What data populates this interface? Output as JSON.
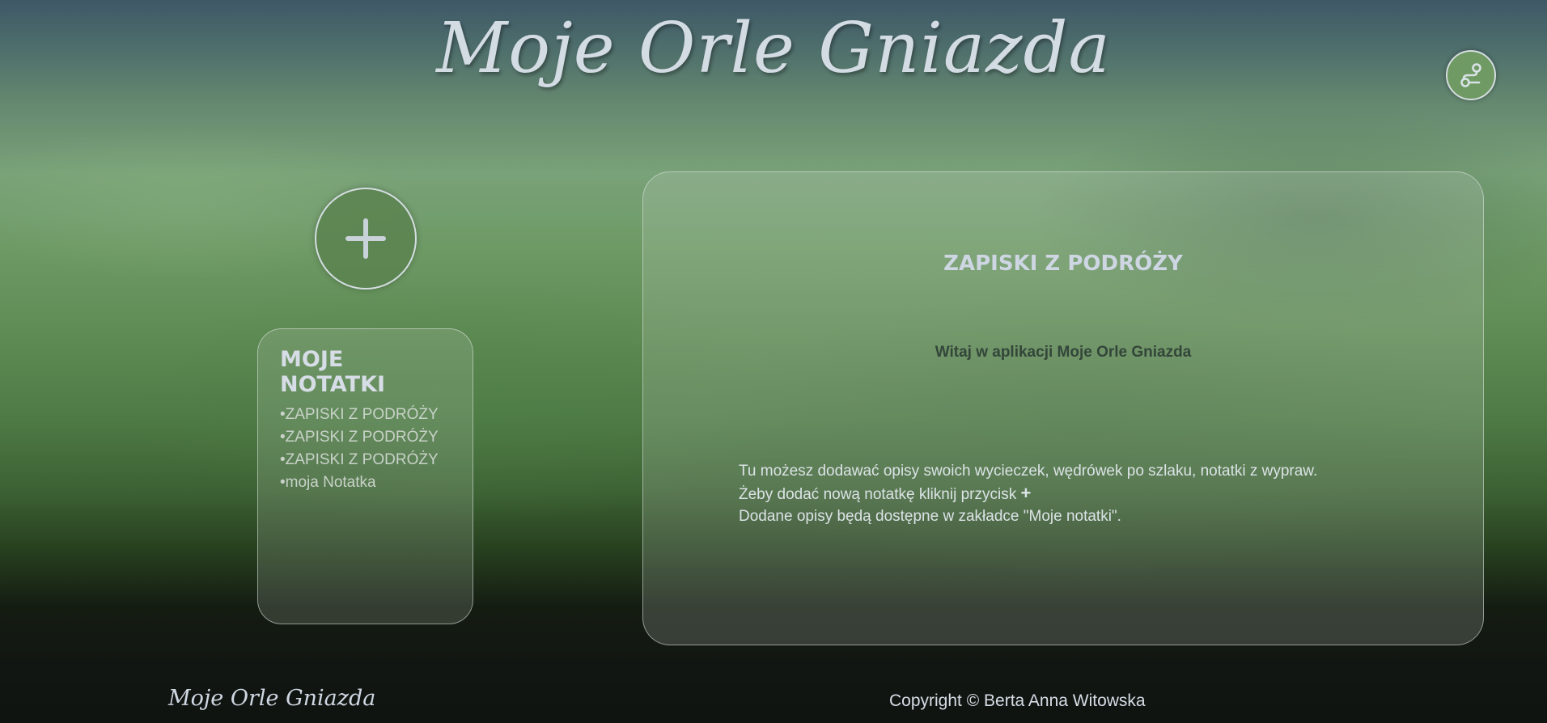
{
  "header": {
    "title": "Moje Orle Gniazda",
    "route_button_icon": "route-icon"
  },
  "sidebar": {
    "add_button_icon": "plus-icon",
    "notes_title": "MOJE NOTATKI",
    "notes": [
      "ZAPISKI Z PODRÓŻY",
      "ZAPISKI Z PODRÓŻY",
      "ZAPISKI Z PODRÓŻY",
      "moja Notatka"
    ]
  },
  "main": {
    "title": "ZAPISKI Z PODRÓŻY",
    "welcome": "Witaj w aplikacji Moje Orle Gniazda",
    "line1": "Tu możesz dodawać opisy swoich wycieczek, wędrówek po szlaku, notatki z wypraw.",
    "line2": "Żeby dodać nową notatkę kliknij przycisk",
    "line2_icon": "+",
    "line3": "Dodane opisy będą dostępne w zakładce \"Moje notatki\"."
  },
  "footer": {
    "brand": "Moje Orle Gniazda",
    "copyright": "Copyright © Berta Anna Witowska"
  },
  "colors": {
    "accent_green": "#6f9a63",
    "text_light": "#d6dde6",
    "text_dark": "#33463a"
  }
}
